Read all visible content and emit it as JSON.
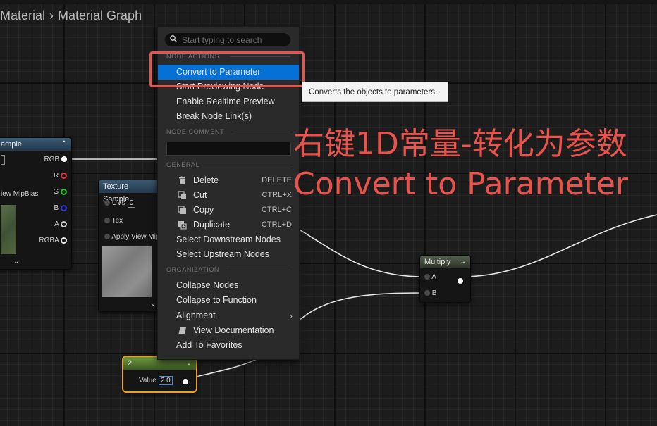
{
  "breadcrumb": {
    "parent": "Material",
    "separator": "›",
    "current": "Material Graph"
  },
  "context_menu": {
    "search_placeholder": "Start typing to search",
    "sections": {
      "node_actions": "NODE ACTIONS",
      "node_comment": "NODE COMMENT",
      "general": "GENERAL",
      "organization": "ORGANIZATION"
    },
    "node_actions": [
      "Convert to Parameter",
      "Start Previewing Node",
      "Enable Realtime Preview",
      "Break Node Link(s)"
    ],
    "general": [
      {
        "label": "Delete",
        "shortcut": "DELETE",
        "icon": "trash-icon"
      },
      {
        "label": "Cut",
        "shortcut": "CTRL+X",
        "icon": "cut-icon"
      },
      {
        "label": "Copy",
        "shortcut": "CTRL+C",
        "icon": "copy-icon"
      },
      {
        "label": "Duplicate",
        "shortcut": "CTRL+D",
        "icon": "duplicate-icon"
      },
      {
        "label": "Select Downstream Nodes"
      },
      {
        "label": "Select Upstream Nodes"
      }
    ],
    "organization": [
      {
        "label": "Collapse Nodes"
      },
      {
        "label": "Collapse to Function"
      },
      {
        "label": "Alignment"
      },
      {
        "label": "View Documentation",
        "icon": "book-icon"
      },
      {
        "label": "Add To Favorites"
      }
    ]
  },
  "tooltip": "Converts the objects to parameters.",
  "annotation": {
    "line1": "右键1D常量-转化为参数",
    "line2": "Convert to Parameter"
  },
  "nodes": {
    "texture_left": {
      "title": "ample",
      "outputs": [
        "RGB",
        "R",
        "G",
        "B",
        "A",
        "RGBA"
      ],
      "input_label": "iew MipBias"
    },
    "texture_sample": {
      "title": "Texture Sample",
      "inputs": [
        "UVs",
        "Tex",
        "Apply View Mip"
      ],
      "uvs_value": "0"
    },
    "multiply": {
      "title": "Multiply",
      "inputs": [
        "A",
        "B"
      ]
    },
    "constant": {
      "title": "2",
      "input_label": "Value",
      "value": "2.0"
    }
  },
  "colors": {
    "highlight": "#0570d6",
    "annotation": "#e8534b"
  }
}
